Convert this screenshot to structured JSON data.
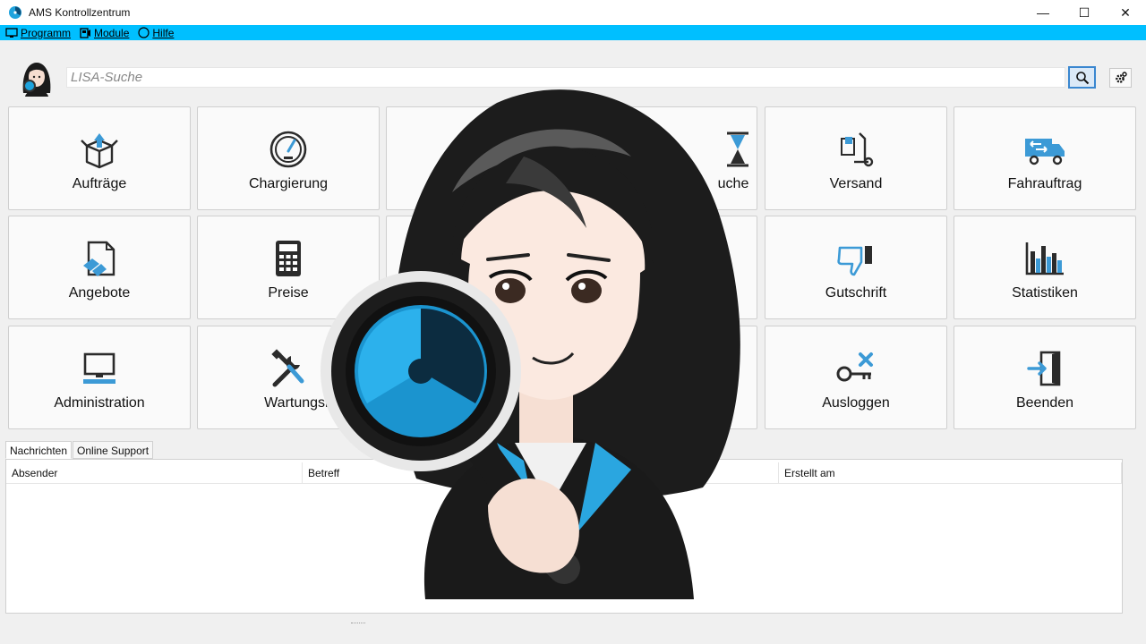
{
  "window": {
    "title": "AMS Kontrollzentrum",
    "minimize": "—",
    "maximize": "☐",
    "close": "✕"
  },
  "menu": {
    "items": [
      {
        "label": "Programm",
        "icon": "monitor-icon"
      },
      {
        "label": "Module",
        "icon": "module-icon"
      },
      {
        "label": "Hilfe",
        "icon": "help-icon"
      }
    ]
  },
  "search": {
    "placeholder": "LISA-Suche",
    "value": ""
  },
  "tiles": {
    "auftraege": {
      "label": "Aufträge",
      "icon": "box-icon"
    },
    "chargierung": {
      "label": "Chargierung",
      "icon": "gauge-icon"
    },
    "suche": {
      "label": "uche",
      "icon": "hourglass-icon"
    },
    "versand": {
      "label": "Versand",
      "icon": "hand-truck-icon"
    },
    "fahrauftrag": {
      "label": "Fahrauftrag",
      "icon": "truck-icon"
    },
    "angebote": {
      "label": "Angebote",
      "icon": "document-icon"
    },
    "preise": {
      "label": "Preise",
      "icon": "calculator-icon"
    },
    "gutschrift": {
      "label": "Gutschrift",
      "icon": "thumbs-down-icon"
    },
    "statistiken": {
      "label": "Statistiken",
      "icon": "bar-chart-icon"
    },
    "administration": {
      "label": "Administration",
      "icon": "computer-icon"
    },
    "wartungsbuch": {
      "label": "Wartungsbuc",
      "icon": "tools-icon"
    },
    "ausloggen": {
      "label": "Ausloggen",
      "icon": "key-icon"
    },
    "beenden": {
      "label": "Beenden",
      "icon": "exit-door-icon"
    }
  },
  "tabs": [
    {
      "label": "Nachrichten",
      "active": true
    },
    {
      "label": "Online Support",
      "active": false
    }
  ],
  "table": {
    "columns": [
      "Absender",
      "Betreff",
      "Erstellt am"
    ],
    "rows": []
  },
  "colors": {
    "accent": "#00bfff",
    "icon_blue": "#3c9ad6",
    "icon_dark": "#2b2b2b"
  }
}
